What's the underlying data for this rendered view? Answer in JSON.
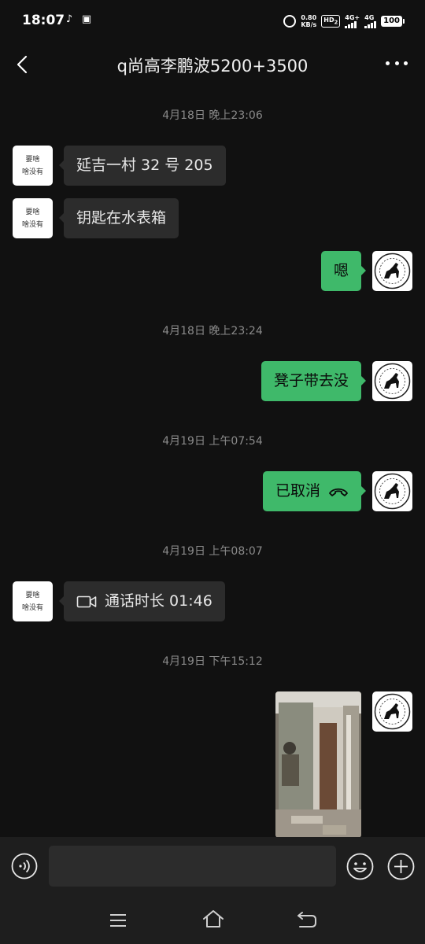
{
  "status_bar": {
    "time": "18:07",
    "net_speed_value": "0.80",
    "net_speed_unit": "KB/s",
    "hd_label": "HD",
    "hd_sub": "2",
    "signal1_label": "4G+",
    "signal2_label": "4G",
    "battery": "100"
  },
  "header": {
    "title": "q尚高李鹏波5200+3500"
  },
  "contact_avatar": {
    "line1": "要啥",
    "line2": "啥没有"
  },
  "messages": {
    "ts1": "4月18日 晚上23:06",
    "m1": "延吉一村 32 号 205",
    "m2": "钥匙在水表箱",
    "m3": "嗯",
    "ts2": "4月18日 晚上23:24",
    "m4": "凳子带去没",
    "ts3": "4月19日 上午07:54",
    "m5": "已取消",
    "ts4": "4月19日 上午08:07",
    "m6": "通话时长 01:46",
    "ts5": "4月19日 下午15:12"
  },
  "input": {
    "placeholder": ""
  },
  "colors": {
    "background": "#111111",
    "sent_bubble": "#3fb96a",
    "received_bubble": "#2c2c2c",
    "input_bar": "#1e1e1e"
  }
}
